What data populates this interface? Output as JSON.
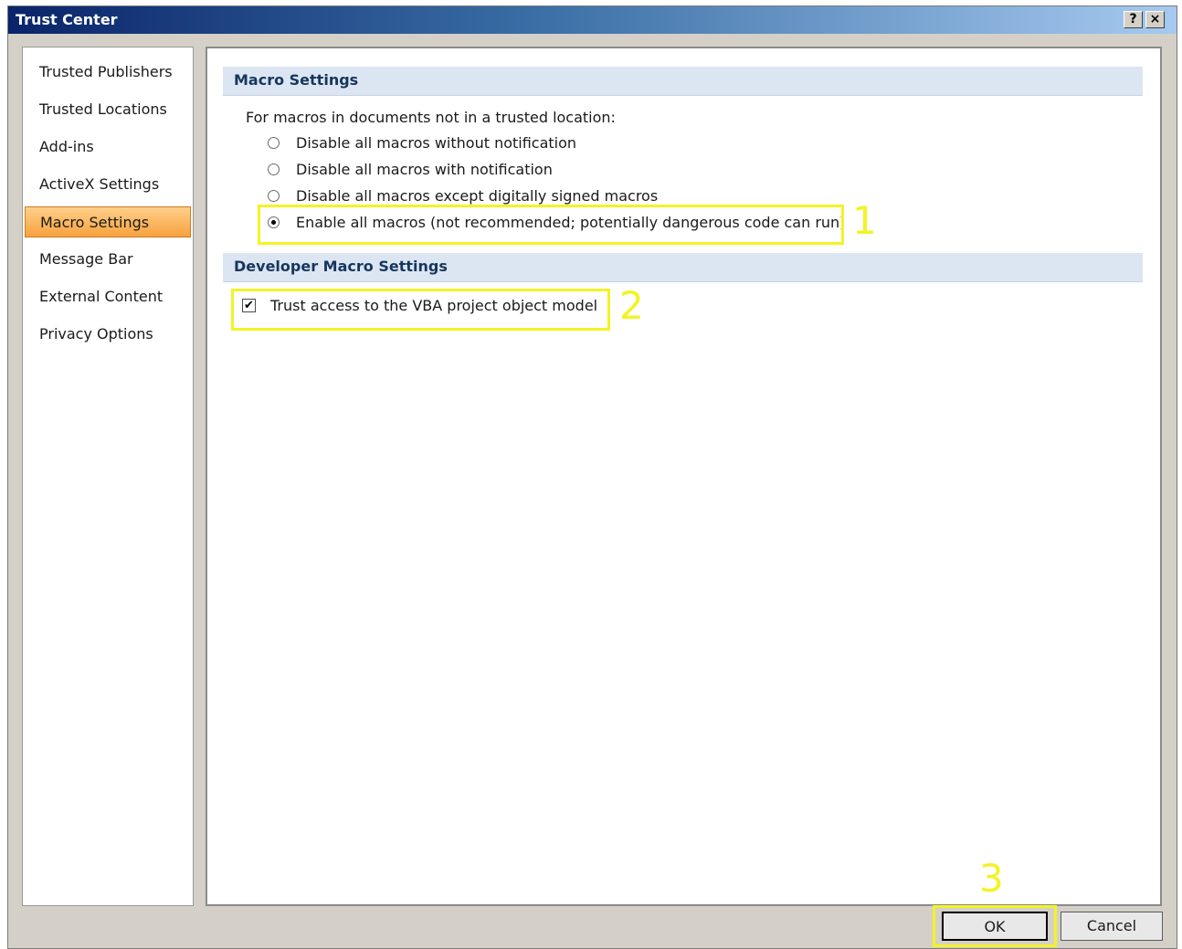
{
  "window": {
    "title": "Trust Center",
    "help_label": "?",
    "close_label": "×"
  },
  "sidebar": {
    "items": [
      {
        "label": "Trusted Publishers",
        "selected": false
      },
      {
        "label": "Trusted Locations",
        "selected": false
      },
      {
        "label": "Add-ins",
        "selected": false
      },
      {
        "label": "ActiveX Settings",
        "selected": false
      },
      {
        "label": "Macro Settings",
        "selected": true
      },
      {
        "label": "Message Bar",
        "selected": false
      },
      {
        "label": "External Content",
        "selected": false
      },
      {
        "label": "Privacy Options",
        "selected": false
      }
    ]
  },
  "macro_settings": {
    "header": "Macro Settings",
    "intro": "For macros in documents not in a trusted location:",
    "options": [
      {
        "label": "Disable all macros without notification",
        "selected": false
      },
      {
        "label": "Disable all macros with notification",
        "selected": false
      },
      {
        "label": "Disable all macros except digitally signed macros",
        "selected": false
      },
      {
        "label": "Enable all macros (not recommended; potentially dangerous code can run)",
        "selected": true
      }
    ]
  },
  "developer": {
    "header": "Developer Macro Settings",
    "trust_vba_label": "Trust access to the VBA project object model",
    "trust_vba_checked": true,
    "check_mark": "✔"
  },
  "buttons": {
    "ok": "OK",
    "cancel": "Cancel"
  },
  "annotations": {
    "step1": "1",
    "step2": "2",
    "step3": "3",
    "highlight_color": "#f3f325"
  }
}
